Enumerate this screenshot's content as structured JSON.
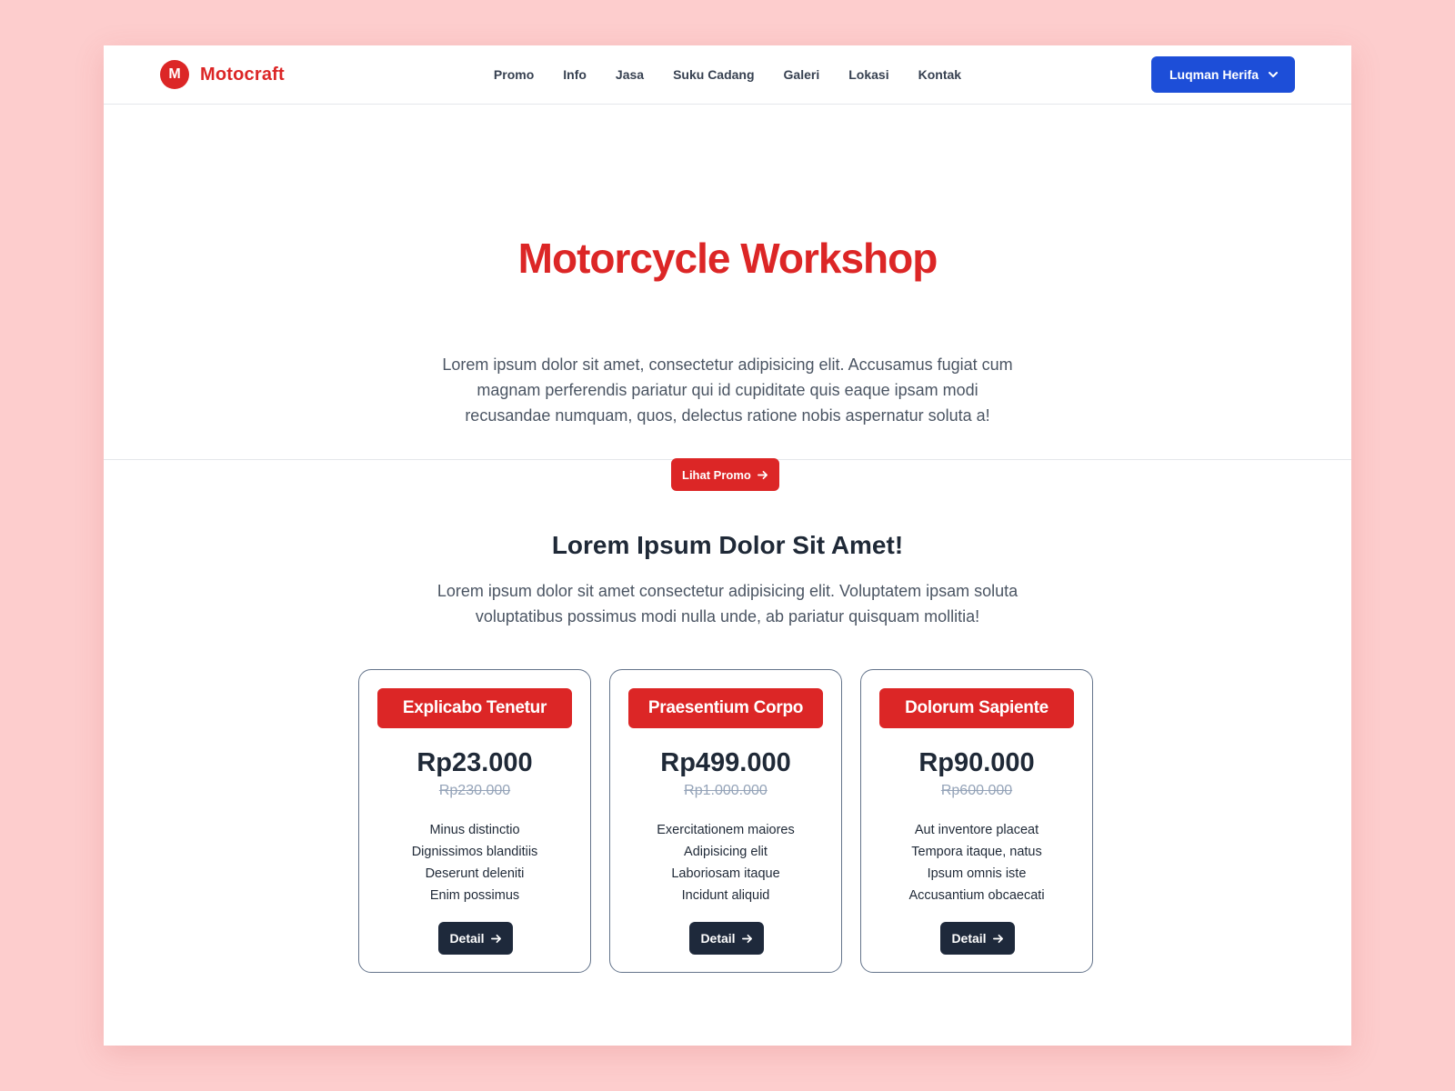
{
  "brand": {
    "logo_letter": "M",
    "name": "Motocraft",
    "color": "#dc2626"
  },
  "nav": {
    "items": [
      "Promo",
      "Info",
      "Jasa",
      "Suku Cadang",
      "Galeri",
      "Lokasi",
      "Kontak"
    ],
    "user_label": "Luqman Herifa",
    "user_icon": "chevron-down-icon",
    "user_button_color": "#1d4ed8"
  },
  "hero": {
    "title": "Motorcycle Workshop",
    "description": "Lorem ipsum dolor sit amet, consectetur adipisicing elit. Accusamus fugiat cum magnam perferendis pariatur qui id cupiditate quis eaque ipsam modi recusandae numquam, quos, delectus ratione nobis aspernatur soluta a!",
    "cta_label": "Lihat Promo",
    "cta_icon": "arrow-right-icon"
  },
  "promo": {
    "heading": "Lorem Ipsum Dolor Sit Amet!",
    "description": "Lorem ipsum dolor sit amet consectetur adipisicing elit. Voluptatem ipsam soluta voluptatibus possimus modi nulla unde, ab pariatur quisquam mollitia!",
    "cards": [
      {
        "title": "Explicabo Tenetur",
        "price": "Rp23.000",
        "old_price": "Rp230.000",
        "features": [
          "Minus distinctio",
          "Dignissimos blanditiis",
          "Deserunt deleniti",
          "Enim possimus"
        ],
        "button": "Detail"
      },
      {
        "title": "Praesentium Corpo",
        "price": "Rp499.000",
        "old_price": "Rp1.000.000",
        "features": [
          "Exercitationem maiores",
          "Adipisicing elit",
          "Laboriosam itaque",
          "Incidunt aliquid"
        ],
        "button": "Detail"
      },
      {
        "title": "Dolorum Sapiente",
        "price": "Rp90.000",
        "old_price": "Rp600.000",
        "features": [
          "Aut inventore placeat",
          "Tempora itaque, natus",
          "Ipsum omnis iste",
          "Accusantium obcaecati"
        ],
        "button": "Detail"
      }
    ]
  }
}
